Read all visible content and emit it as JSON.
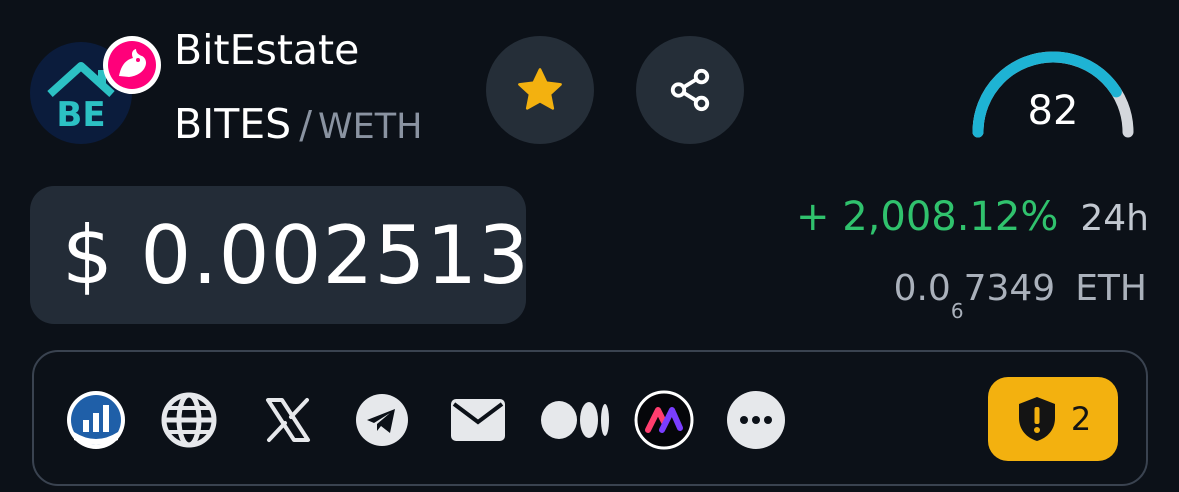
{
  "token": {
    "name": "BitEstate",
    "base_symbol": "BITES",
    "separator": "/",
    "quote_symbol": "WETH",
    "logo_text": "BE"
  },
  "score": {
    "value": "82",
    "fraction": 0.82
  },
  "price": {
    "usd": "$ 0.002513",
    "change": "+ 2,008.12%",
    "period": "24h",
    "eth_prefix": "0.0",
    "eth_zero_count": "6",
    "eth_digits": "7349",
    "eth_unit": "ETH"
  },
  "links": [
    {
      "icon": "chart-icon"
    },
    {
      "icon": "globe-icon"
    },
    {
      "icon": "x-icon"
    },
    {
      "icon": "telegram-icon"
    },
    {
      "icon": "mail-icon"
    },
    {
      "icon": "medium-icon"
    },
    {
      "icon": "app-icon"
    },
    {
      "icon": "more-icon"
    }
  ],
  "audit": {
    "icon": "shield-alert-icon",
    "count": "2"
  },
  "colors": {
    "background": "#0c1118",
    "panel": "#232c37",
    "button": "#252e38",
    "positive": "#30c26d",
    "star": "#f3b10f",
    "gauge": "#1eb3d4",
    "audit_badge": "#f3b10f"
  }
}
